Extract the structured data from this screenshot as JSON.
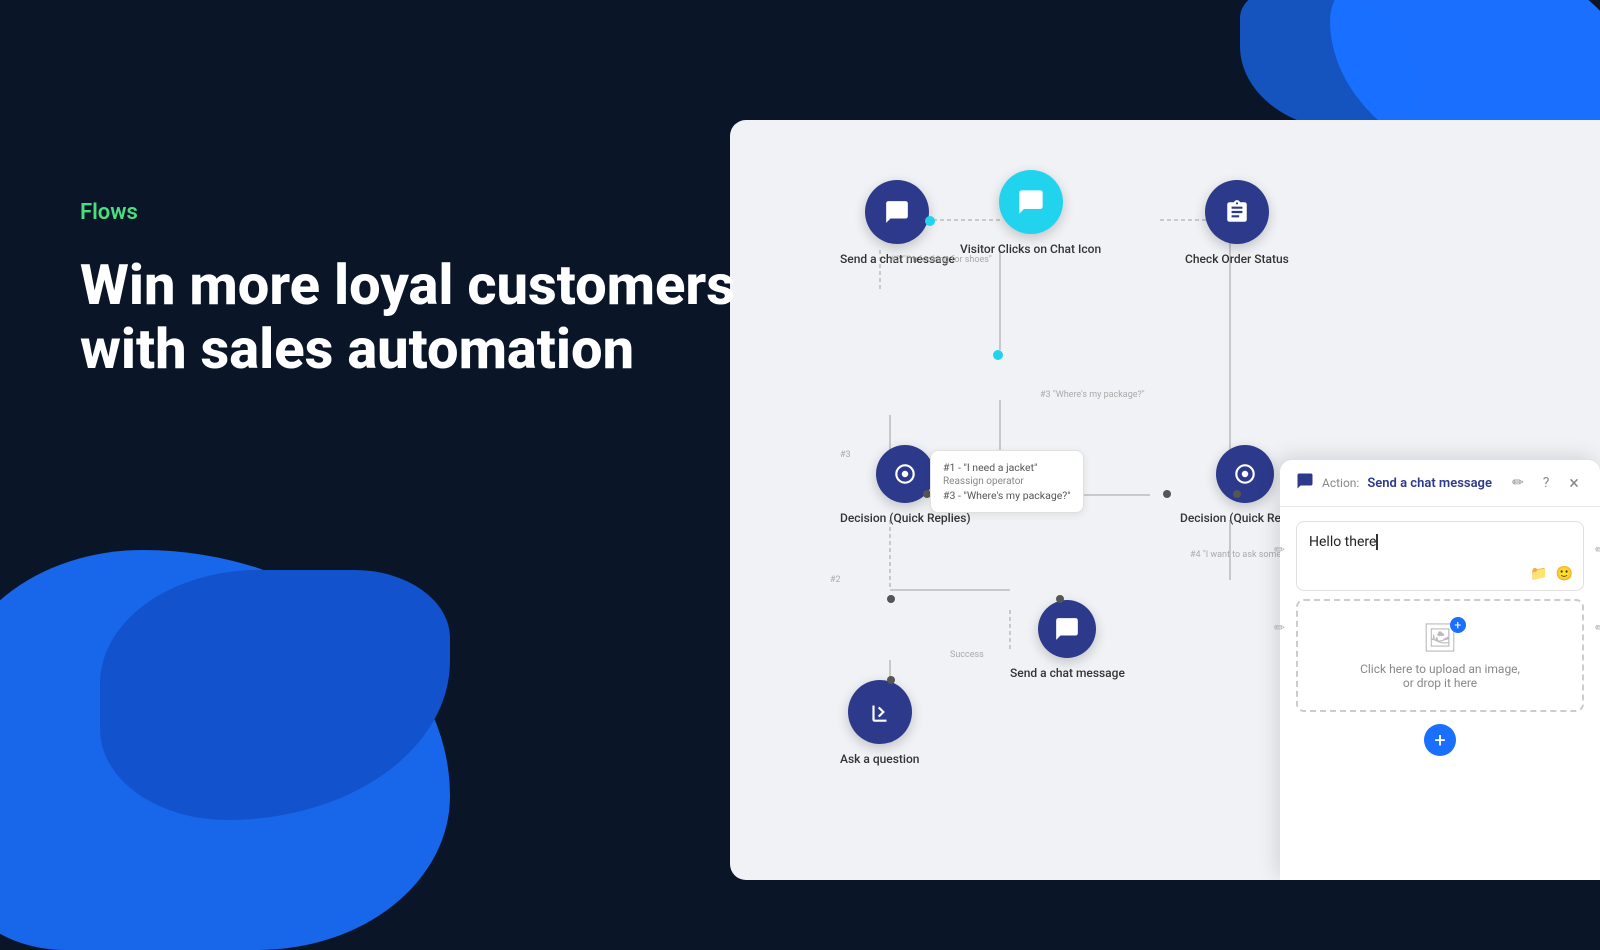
{
  "background": {
    "color": "#0a1628"
  },
  "left": {
    "flows_label": "Flows",
    "headline_line1": "Win more loyal customers",
    "headline_line2": "with sales automation"
  },
  "flow": {
    "nodes": [
      {
        "id": "visitor-click",
        "label": "Visitor Clicks on Chat Icon",
        "type": "chat",
        "color": "cyan"
      },
      {
        "id": "send-chat-top",
        "label": "Send a chat message",
        "type": "chat",
        "color": "dark"
      },
      {
        "id": "check-order",
        "label": "Check Order Status",
        "type": "clipboard",
        "color": "dark"
      },
      {
        "id": "decision1",
        "label": "Decision (Quick Replies)",
        "type": "decision",
        "color": "dark"
      },
      {
        "id": "decision2",
        "label": "Decision (Quick Replies)",
        "type": "decision",
        "color": "dark"
      },
      {
        "id": "send-chat-bottom",
        "label": "Send a chat message",
        "type": "chat",
        "color": "dark"
      },
      {
        "id": "ask-question",
        "label": "Ask a question",
        "type": "ask",
        "color": "dark"
      }
    ],
    "decision_popup": {
      "items": [
        "#1 - \"I need a jacket\"",
        "Reassign operator",
        "#3 - \"Where's my package?\""
      ]
    }
  },
  "action_panel": {
    "header": {
      "action_label": "Action:",
      "action_name": "Send a chat message",
      "edit_icon": "✏",
      "help_icon": "?",
      "close_icon": "×"
    },
    "message_box": {
      "text": "Hello there",
      "folder_icon": "📁",
      "emoji_icon": "🙂"
    },
    "image_upload": {
      "text": "Click here to upload an image,",
      "text2": "or drop it here"
    },
    "add_button_label": "+"
  }
}
